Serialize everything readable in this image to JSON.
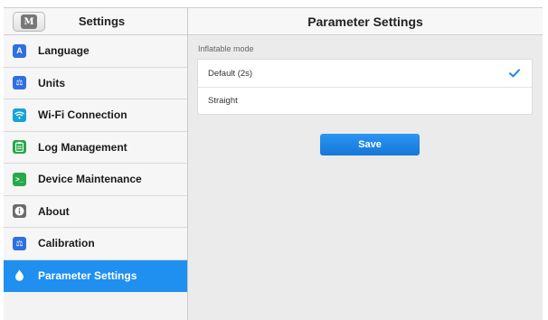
{
  "sidebar": {
    "title": "Settings",
    "home_label": "M",
    "items": [
      {
        "label": "Language",
        "icon": "language-icon",
        "icon_text": "A",
        "color": "#2f6fe0",
        "active": false
      },
      {
        "label": "Units",
        "icon": "units-icon",
        "icon_text": "⚖",
        "color": "#2f6fe0",
        "active": false
      },
      {
        "label": "Wi-Fi Connection",
        "icon": "wifi-icon",
        "icon_text": "",
        "color": "#16a3d6",
        "active": false
      },
      {
        "label": "Log Management",
        "icon": "log-icon",
        "icon_text": "",
        "color": "#27a84a",
        "active": false
      },
      {
        "label": "Device Maintenance",
        "icon": "maintenance-icon",
        "icon_text": ">_",
        "color": "#27a84a",
        "active": false
      },
      {
        "label": "About",
        "icon": "about-icon",
        "icon_text": "i",
        "color": "#6b6b6b",
        "active": false
      },
      {
        "label": "Calibration",
        "icon": "calibration-icon",
        "icon_text": "⚖",
        "color": "#2f6fe0",
        "active": false
      },
      {
        "label": "Parameter Settings",
        "icon": "drop-icon",
        "icon_text": "",
        "color": "#ffffff",
        "active": true
      }
    ]
  },
  "main": {
    "title": "Parameter Settings",
    "section_label": "Inflatable mode",
    "options": [
      {
        "label": "Default (2s)",
        "selected": true
      },
      {
        "label": "Straight",
        "selected": false
      }
    ],
    "save_label": "Save"
  },
  "colors": {
    "accent": "#1f8ff0",
    "check": "#1f86e8"
  }
}
